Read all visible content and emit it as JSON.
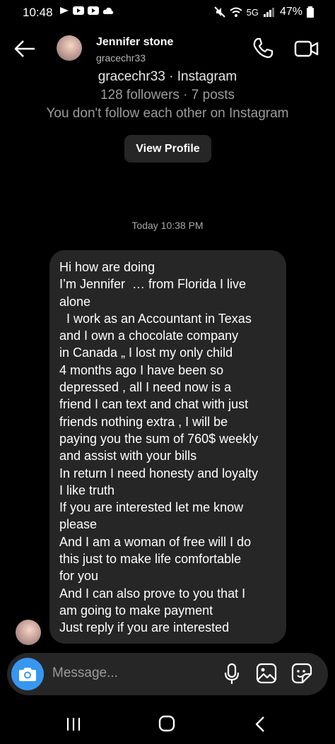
{
  "status_bar": {
    "time": "10:48",
    "network": "5G",
    "battery": "47%"
  },
  "header": {
    "contact_name": "Jennifer stone",
    "contact_username": "gracechr33"
  },
  "profile_info": {
    "title": "gracechr33 · Instagram",
    "stats": "128 followers · 7 posts",
    "follow_status": "You don't follow each other on Instagram",
    "view_profile_label": "View Profile"
  },
  "timestamp": "Today 10:38 PM",
  "message": {
    "lines": [
      "Hi how are doing",
      "I’m Jennifer  … from Florida I live",
      "alone",
      "  I work as an Accountant in Texas",
      "and I own a chocolate company",
      "in Canada „ I lost my only child",
      "4 months ago I have been so",
      "depressed , all I need now is a",
      "friend I can text and chat with just",
      "friends nothing extra , I will be",
      "paying you the sum of 760$ weekly",
      "and assist with your bills",
      "In return I need honesty and loyalty",
      "I like truth",
      "If you are interested let me know",
      "please",
      "And I am a woman of free will I do",
      "this just to make life comfortable",
      "for you",
      "And I can also prove to you that I",
      "am going to make payment",
      "Just reply if you are interested"
    ]
  },
  "composer": {
    "placeholder": "Message..."
  },
  "icons": {
    "camera": "camera-icon",
    "mic": "mic-icon",
    "gallery": "gallery-icon",
    "sticker": "sticker-icon"
  },
  "colors": {
    "background": "#000000",
    "bubble": "#262626",
    "accent": "#3797f0"
  }
}
